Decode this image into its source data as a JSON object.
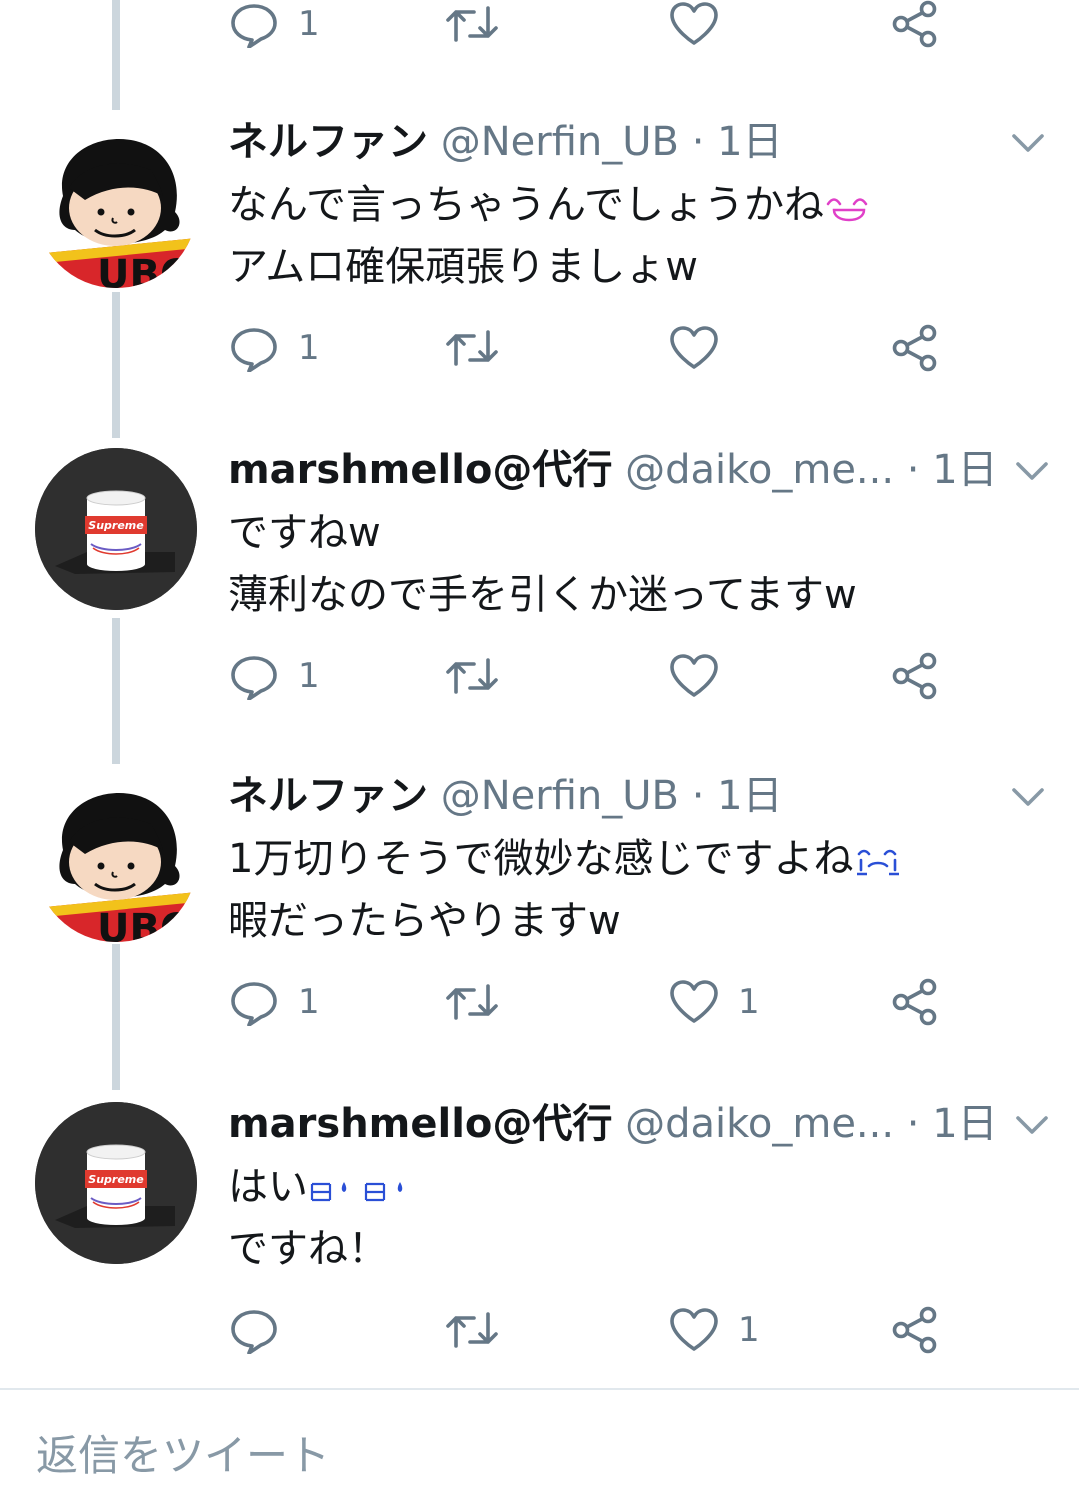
{
  "tweets": [
    {
      "name": "",
      "handle": "",
      "time": "",
      "lines": [],
      "reply_count": "1",
      "retweet_count": "",
      "like_count": "",
      "avatar": "none"
    },
    {
      "name": "ネルファン",
      "handle": "@Nerfin_UB",
      "sep": "·",
      "time": "1日",
      "lines": [
        "なんで言っちゃうんでしょうかね",
        "アムロ確保頑張りましょw"
      ],
      "emoji": "pink-grin-emoji",
      "reply_count": "1",
      "retweet_count": "",
      "like_count": "",
      "avatar": "cartoon-boy-avatar"
    },
    {
      "name": "marshmello@代行",
      "handle": "@daiko_me...",
      "sep": "·",
      "time": "1日",
      "lines": [
        "ですねw",
        "薄利なので手を引くか迷ってますw"
      ],
      "reply_count": "1",
      "retweet_count": "",
      "like_count": "",
      "avatar": "supreme-can-avatar"
    },
    {
      "name": "ネルファン",
      "handle": "@Nerfin_UB",
      "sep": "·",
      "time": "1日",
      "lines": [
        "1万切りそうで微妙な感じですよね",
        "暇だったらやりますw"
      ],
      "emoji": "blue-crying-emoji",
      "reply_count": "1",
      "retweet_count": "",
      "like_count": "1",
      "avatar": "cartoon-boy-avatar"
    },
    {
      "name": "marshmello@代行",
      "handle": "@daiko_me...",
      "sep": "·",
      "time": "1日",
      "lines": [
        "はい",
        "ですね！"
      ],
      "emoji": "blue-sweat-emoji",
      "reply_count": "",
      "retweet_count": "",
      "like_count": "1",
      "avatar": "supreme-can-avatar"
    }
  ],
  "reply_compose": {
    "placeholder": "返信をツイート"
  },
  "icons": {
    "reply": "reply-icon",
    "retweet": "retweet-icon",
    "like": "heart-icon",
    "share": "share-icon",
    "menu": "chevron-down-icon"
  },
  "colors": {
    "text": "#14171a",
    "secondary": "#657786",
    "thread_line": "#ccd6dd",
    "divider": "#e1e8ed",
    "placeholder": "#8899a6",
    "supreme_red": "#e03a2f"
  }
}
